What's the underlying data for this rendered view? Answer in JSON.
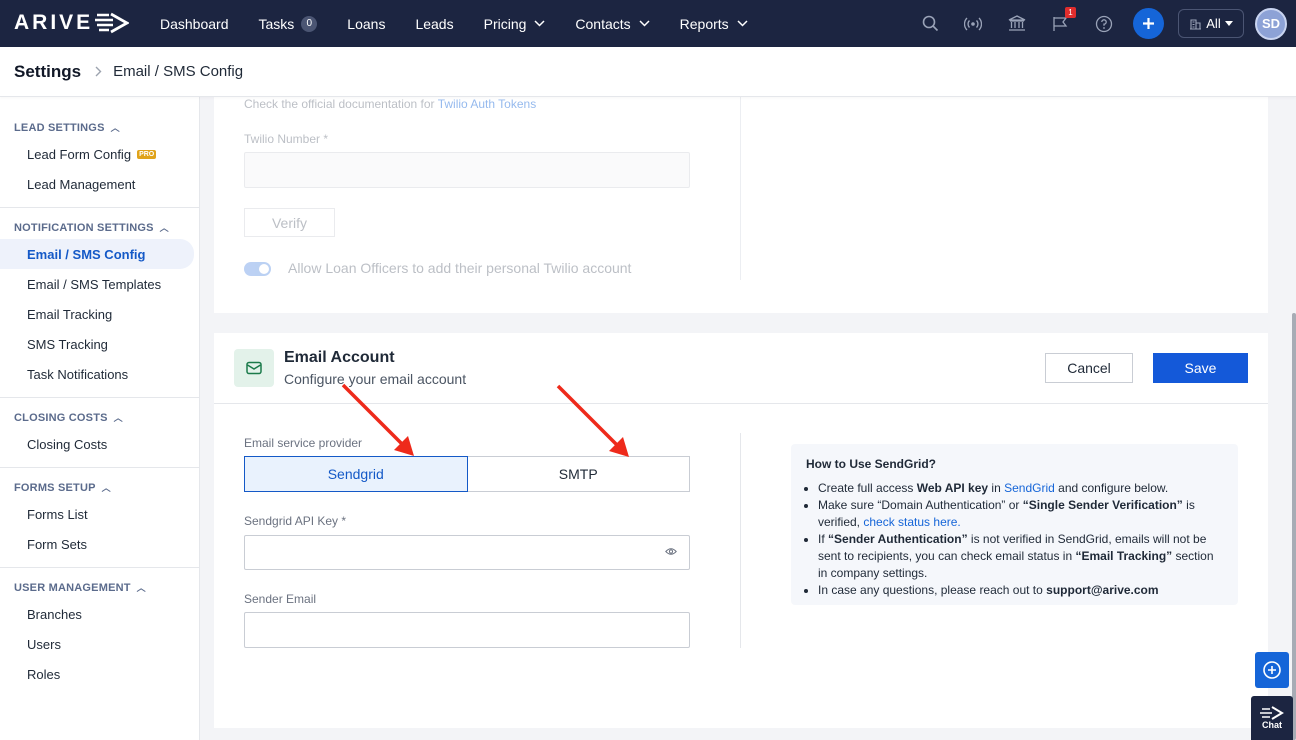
{
  "nav": {
    "logo": "ARIVE",
    "items": [
      {
        "label": "Dashboard"
      },
      {
        "label": "Tasks",
        "badge": "0"
      },
      {
        "label": "Loans"
      },
      {
        "label": "Leads"
      },
      {
        "label": "Pricing",
        "dropdown": true
      },
      {
        "label": "Contacts",
        "dropdown": true
      },
      {
        "label": "Reports",
        "dropdown": true
      }
    ],
    "notification_count": "1",
    "scope_select": "All",
    "avatar_initials": "SD"
  },
  "header": {
    "title": "Settings",
    "breadcrumb": "Email / SMS Config"
  },
  "sidebar": {
    "groups": [
      {
        "title": "LEAD SETTINGS",
        "items": [
          {
            "label": "Lead Form Config",
            "badge": "PRO"
          },
          {
            "label": "Lead Management"
          }
        ]
      },
      {
        "title": "NOTIFICATION SETTINGS",
        "items": [
          {
            "label": "Email / SMS Config",
            "active": true
          },
          {
            "label": "Email / SMS Templates"
          },
          {
            "label": "Email Tracking"
          },
          {
            "label": "SMS Tracking"
          },
          {
            "label": "Task Notifications"
          }
        ]
      },
      {
        "title": "CLOSING COSTS",
        "items": [
          {
            "label": "Closing Costs"
          }
        ]
      },
      {
        "title": "FORMS SETUP",
        "items": [
          {
            "label": "Forms List"
          },
          {
            "label": "Form Sets"
          }
        ]
      },
      {
        "title": "USER MANAGEMENT",
        "items": [
          {
            "label": "Branches"
          },
          {
            "label": "Users"
          },
          {
            "label": "Roles"
          }
        ]
      }
    ]
  },
  "twilio": {
    "doc_prefix": "Check the official documentation for",
    "doc_link": "Twilio Auth Tokens",
    "number_label": "Twilio Number *",
    "number_value": "",
    "verify_label": "Verify",
    "allow_toggle_label": "Allow Loan Officers to add their personal Twilio account",
    "allow_toggle_on": true
  },
  "email_account": {
    "title": "Email Account",
    "subtitle": "Configure your email account",
    "cancel_label": "Cancel",
    "save_label": "Save",
    "provider_label": "Email service provider",
    "providers": [
      "Sendgrid",
      "SMTP"
    ],
    "selected_provider": "Sendgrid",
    "api_key_label": "Sendgrid API Key *",
    "api_key_value": "",
    "sender_email_label": "Sender Email",
    "sender_email_value": ""
  },
  "help": {
    "title": "How to Use SendGrid?",
    "b1_pre": "Create full access ",
    "b1_bold": "Web API key",
    "b1_mid": " in ",
    "b1_link": "SendGrid",
    "b1_post": " and configure below.",
    "b2_pre": "Make sure “Domain Authentication” or ",
    "b2_bold": "“Single Sender Verification”",
    "b2_mid": " is verified, ",
    "b2_link": "check status here.",
    "b3_pre": "If ",
    "b3_bold": "“Sender Authentication”",
    "b3_mid": " is not verified in SendGrid, emails will not be sent to recipients, you can check email status in ",
    "b3_bold2": "“Email Tracking”",
    "b3_post": " section in company settings.",
    "b4_pre": "In case any questions, please reach out to ",
    "b4_email": "support@arive.com"
  },
  "chat_label": "Chat",
  "colors": {
    "nav_bg": "#1c2541",
    "accent": "#1459d9",
    "annotation_arrow": "#ee2a1b"
  }
}
